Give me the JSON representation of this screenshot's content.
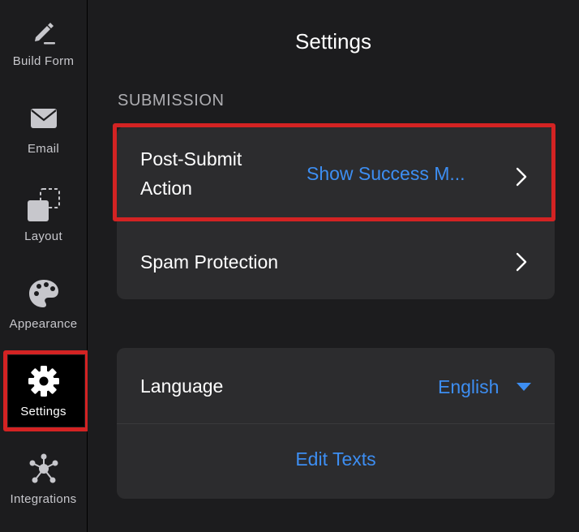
{
  "sidebar": {
    "items": [
      {
        "label": "Build Form",
        "icon": "pencil-icon"
      },
      {
        "label": "Email",
        "icon": "envelope-icon"
      },
      {
        "label": "Layout",
        "icon": "layout-icon"
      },
      {
        "label": "Appearance",
        "icon": "palette-icon"
      },
      {
        "label": "Settings",
        "icon": "gear-icon",
        "active": true
      },
      {
        "label": "Integrations",
        "icon": "integrations-icon"
      }
    ]
  },
  "main": {
    "title": "Settings",
    "section_label": "SUBMISSION",
    "post_submit": {
      "title_line1": "Post-Submit",
      "title_line2": "Action",
      "value": "Show Success M..."
    },
    "spam": {
      "title": "Spam Protection"
    },
    "language": {
      "title": "Language",
      "value": "English"
    },
    "edit_texts": "Edit Texts"
  },
  "colors": {
    "accent": "#3d8ef2",
    "highlight": "#d32323",
    "background": "#1c1c1e",
    "panel": "#2c2c2e"
  }
}
